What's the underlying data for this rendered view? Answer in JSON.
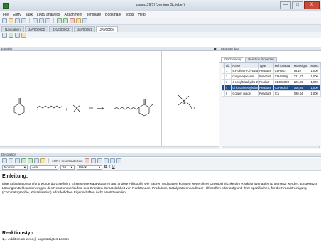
{
  "window": {
    "title": "pxpmx19[1] (Jeiniger Scrieber)",
    "buttons": {
      "minimize": "—",
      "maximize": "□",
      "close": "X"
    }
  },
  "menu": [
    "File",
    "Entry",
    "Task",
    "LIMS analytics",
    "Attachment",
    "Template",
    "Bookmark",
    "Tools",
    "Help"
  ],
  "tabs": [
    {
      "label": "Navigation",
      "active": false
    },
    {
      "label": "JAV000002",
      "active": false
    },
    {
      "label": "JAV000002",
      "active": false
    },
    {
      "label": "JAV00001",
      "active": false
    },
    {
      "label": "JAV00004",
      "active": true
    }
  ],
  "equation_panel": {
    "label": "Equation",
    "pin": "▣"
  },
  "reaction_panel": {
    "label": "Reaction data",
    "tabs": [
      {
        "label": "Stoichiometry",
        "active": true
      },
      {
        "label": "Reaction Properties",
        "active": false
      }
    ],
    "columns": [
      "",
      "Idx",
      "Name",
      "Type",
      "Mol formula",
      "Molweight",
      "Molec"
    ],
    "rows": [
      {
        "marker": "",
        "idx": "1",
        "name": "5,6-dihydro-2h-pyran-",
        "type": "Reactant",
        "formula": "C5H6O2",
        "mw": "98,10",
        "mol": "1,000",
        "selected": false
      },
      {
        "marker": "",
        "idx": "2",
        "name": "nonylmagnesium",
        "type": "Reactant",
        "formula": "C9H19MgI",
        "mw": "221,47",
        "mol": "1,000",
        "selected": false
      },
      {
        "marker": "",
        "idx": "3",
        "name": "4-nonyltetrahydro-2H-",
        "type": "Product",
        "formula": "C14H26O2",
        "mw": "226,36",
        "mol": "1,000",
        "selected": false
      },
      {
        "marker": "",
        "idx": "4",
        "name": "Chlorotrimethylsilane",
        "type": "Reactant",
        "formula": "C3H9ClSi",
        "mw": "108,64",
        "mol": "1,000",
        "selected": true
      },
      {
        "marker": "",
        "idx": "5",
        "name": "Copper iodide",
        "type": "Reactant",
        "formula": "ICu",
        "mw": "190,44",
        "mol": "1,000",
        "selected": false
      }
    ]
  },
  "equation": {
    "plus": "+",
    "arrow": "⟶",
    "si": "Si",
    "cl": "Cl"
  },
  "description": {
    "label": "Description",
    "font": "Arial",
    "style": "Normal",
    "size": "10",
    "color": "Black",
    "zoom": "100%",
    "insert": "Insert auto-text",
    "heading1": "Einleitung:",
    "paragraph": "Eine Substitutionsprüfung wurde durchgeführt. Eingesetzte Katalysatoren und andere Hilfsstoffe wie Säuren und Basen konnten wegen ihrer Unentbehrlichkeit im Reaktionsverlaufe nicht ersetzt werden. Eingesetzte Lösungsmittel konnten wegen des Reaktionsverlaufes, aus Gründen der Löslichkeit von Reaktanden, Produkten, Katalysatoren und/oder Hilfsstoffen oder aufgrund ihrer spezifischen, für die Produktreinigung (Chromatographie, Kristallisation) erforderlichen Eigenschaften nicht ersetzt werden.",
    "heading2": "Reaktionstyp:",
    "reaction_type": "1,4-Addition an ein α,β-ungesättigtes Lacton"
  },
  "icons": {
    "toolbar": [
      "new-icon",
      "open-icon",
      "save-icon",
      "print-icon",
      "cut-icon",
      "copy-icon",
      "paste-icon",
      "undo-icon",
      "redo-icon",
      "sign-icon",
      "lock-icon",
      "search-icon"
    ],
    "toolbar2": [
      "equation-icon",
      "refresh-icon",
      "table-icon",
      "export-icon"
    ]
  },
  "colors": {
    "selection": "#1f4f8f",
    "app_icon": "#2e7d32"
  }
}
